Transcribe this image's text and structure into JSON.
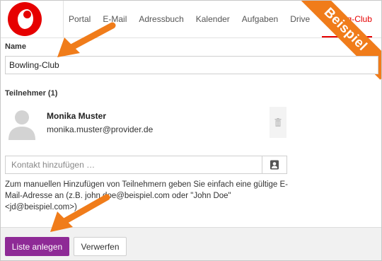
{
  "header": {
    "logo_icon": "vodafone-logo",
    "nav": [
      "Portal",
      "E-Mail",
      "Adressbuch",
      "Kalender",
      "Aufgaben",
      "Drive",
      "Bowling-Club"
    ],
    "active_index": 6,
    "ribbon_text": "Beispiel"
  },
  "form": {
    "name_label": "Name",
    "name_value": "Bowling-Club",
    "participants_label": "Teilnehmer (1)",
    "participant": {
      "name": "Monika Muster",
      "email": "monika.muster@provider.de",
      "avatar_icon": "person-silhouette-icon",
      "remove_icon": "trash-icon"
    },
    "contact_placeholder": "Kontakt hinzufügen …",
    "addressbook_icon": "address-book-icon",
    "help_text": "Zum manuellen Hinzufügen von Teilnehmern geben Sie einfach eine gültige E-Mail-Adresse an (z.B. john.doe@beispiel.com oder \"John Doe\" <jd@beispiel.com>)"
  },
  "footer": {
    "primary_label": "Liste anlegen",
    "secondary_label": "Verwerfen"
  },
  "colors": {
    "brand_red": "#e60000",
    "accent_purple": "#8e2a96",
    "annotation_orange": "#f07c1a"
  }
}
